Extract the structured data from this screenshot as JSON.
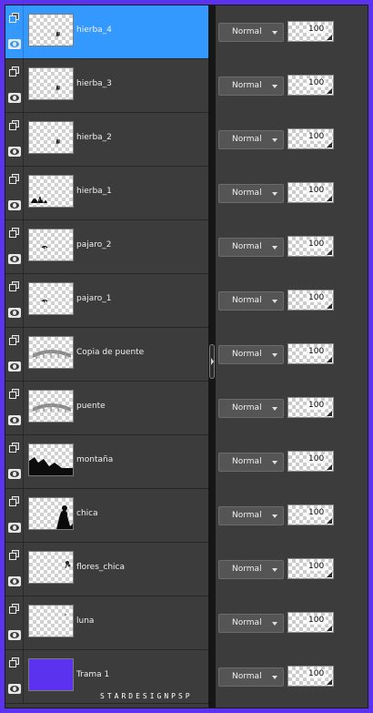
{
  "panel": {
    "layers": [
      {
        "name": "hierba_4",
        "selected": true,
        "thumb": "grass-sprig",
        "blend_mode": "Normal",
        "opacity": "100"
      },
      {
        "name": "hierba_3",
        "selected": false,
        "thumb": "grass-sprig",
        "blend_mode": "Normal",
        "opacity": "100"
      },
      {
        "name": "hierba_2",
        "selected": false,
        "thumb": "grass-sprig",
        "blend_mode": "Normal",
        "opacity": "100"
      },
      {
        "name": "hierba_1",
        "selected": false,
        "thumb": "grass-clump",
        "blend_mode": "Normal",
        "opacity": "100"
      },
      {
        "name": "pajaro_2",
        "selected": false,
        "thumb": "bird",
        "blend_mode": "Normal",
        "opacity": "100"
      },
      {
        "name": "pajaro_1",
        "selected": false,
        "thumb": "bird",
        "blend_mode": "Normal",
        "opacity": "100"
      },
      {
        "name": "Copia de puente",
        "selected": false,
        "thumb": "bridge",
        "blend_mode": "Normal",
        "opacity": "100"
      },
      {
        "name": "puente",
        "selected": false,
        "thumb": "bridge",
        "blend_mode": "Normal",
        "opacity": "100"
      },
      {
        "name": "montaña",
        "selected": false,
        "thumb": "mountain",
        "blend_mode": "Normal",
        "opacity": "100"
      },
      {
        "name": "chica",
        "selected": false,
        "thumb": "girl",
        "blend_mode": "Normal",
        "opacity": "100"
      },
      {
        "name": "flores_chica",
        "selected": false,
        "thumb": "flowers",
        "blend_mode": "Normal",
        "opacity": "100"
      },
      {
        "name": "luna",
        "selected": false,
        "thumb": "moon",
        "blend_mode": "Normal",
        "opacity": "100"
      },
      {
        "name": "Trama 1",
        "selected": false,
        "thumb": "solid-fill",
        "blend_mode": "Normal",
        "opacity": "100"
      }
    ]
  },
  "watermark": "STARDESIGNPSP",
  "colors": {
    "background": "#5b33ee",
    "panel": "#3c3c3c",
    "selected": "#3399ff",
    "fill_layer": "#5b33ee"
  }
}
